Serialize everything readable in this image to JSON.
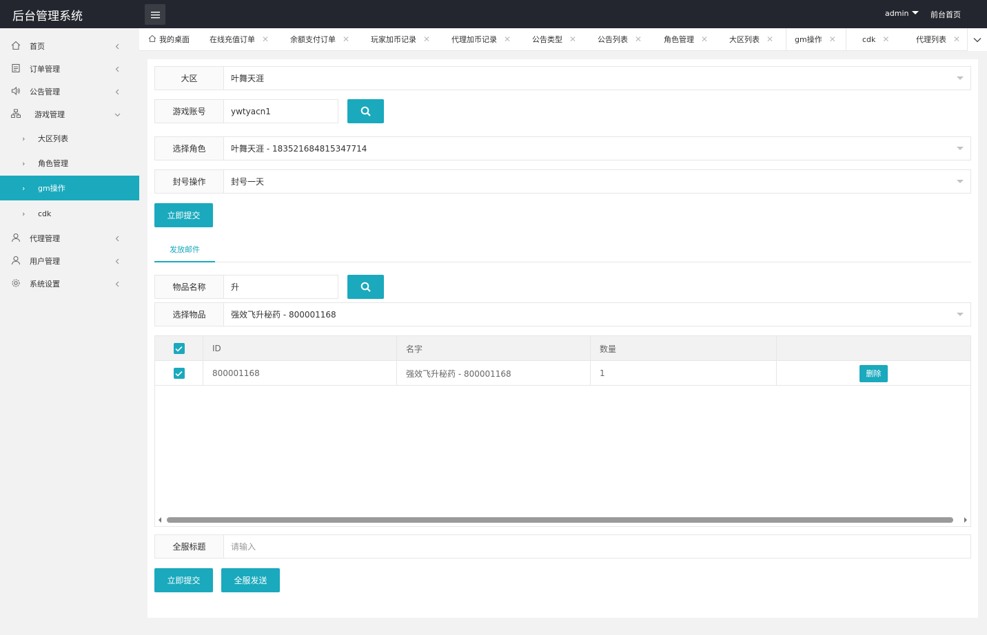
{
  "app": {
    "title": "后台管理系统",
    "user": "admin",
    "front_link": "前台首页"
  },
  "sidebar": {
    "items": [
      {
        "label": "首页",
        "icon": "home-icon"
      },
      {
        "label": "订单管理",
        "icon": "list-icon"
      },
      {
        "label": "公告管理",
        "icon": "speaker-icon"
      },
      {
        "label": "游戏管理",
        "icon": "sitemap-icon",
        "expanded": true
      }
    ],
    "subitems": [
      {
        "label": "大区列表"
      },
      {
        "label": "角色管理"
      },
      {
        "label": "gm操作",
        "active": true
      },
      {
        "label": "cdk"
      }
    ],
    "items_after": [
      {
        "label": "代理管理",
        "icon": "user-icon"
      },
      {
        "label": "用户管理",
        "icon": "user-icon"
      },
      {
        "label": "系统设置",
        "icon": "gear-icon"
      }
    ]
  },
  "tabs": [
    {
      "label": "我的桌面"
    },
    {
      "label": "在线充值订单"
    },
    {
      "label": "余额支付订单"
    },
    {
      "label": "玩家加币记录"
    },
    {
      "label": "代理加币记录"
    },
    {
      "label": "公告类型"
    },
    {
      "label": "公告列表"
    },
    {
      "label": "角色管理"
    },
    {
      "label": "大区列表"
    },
    {
      "label": "gm操作",
      "active": true
    },
    {
      "label": "cdk"
    },
    {
      "label": "代理列表"
    }
  ],
  "form": {
    "region_label": "大区",
    "region_value": "叶舞天涯",
    "account_label": "游戏账号",
    "account_value": "ywtyacn1",
    "role_label": "选择角色",
    "role_value": "叶舞天涯 - 183521684815347714",
    "ban_label": "封号操作",
    "ban_value": "封号一天",
    "submit_label": "立即提交"
  },
  "mail": {
    "tab_label": "发放邮件",
    "item_name_label": "物品名称",
    "item_name_value": "升",
    "select_item_label": "选择物品",
    "select_item_value": "强效飞升秘药 - 800001168",
    "table": {
      "columns": [
        "ID",
        "名字",
        "数量"
      ],
      "rows": [
        {
          "id": "800001168",
          "name": "强效飞升秘药 - 800001168",
          "qty": "1",
          "action": "删除",
          "checked": true
        }
      ]
    },
    "server_title_label": "全服标题",
    "server_title_placeholder": "请输入",
    "submit_label": "立即提交",
    "broadcast_label": "全服发送"
  },
  "colors": {
    "accent": "#1aa9bd",
    "header_bg": "#23262e"
  }
}
